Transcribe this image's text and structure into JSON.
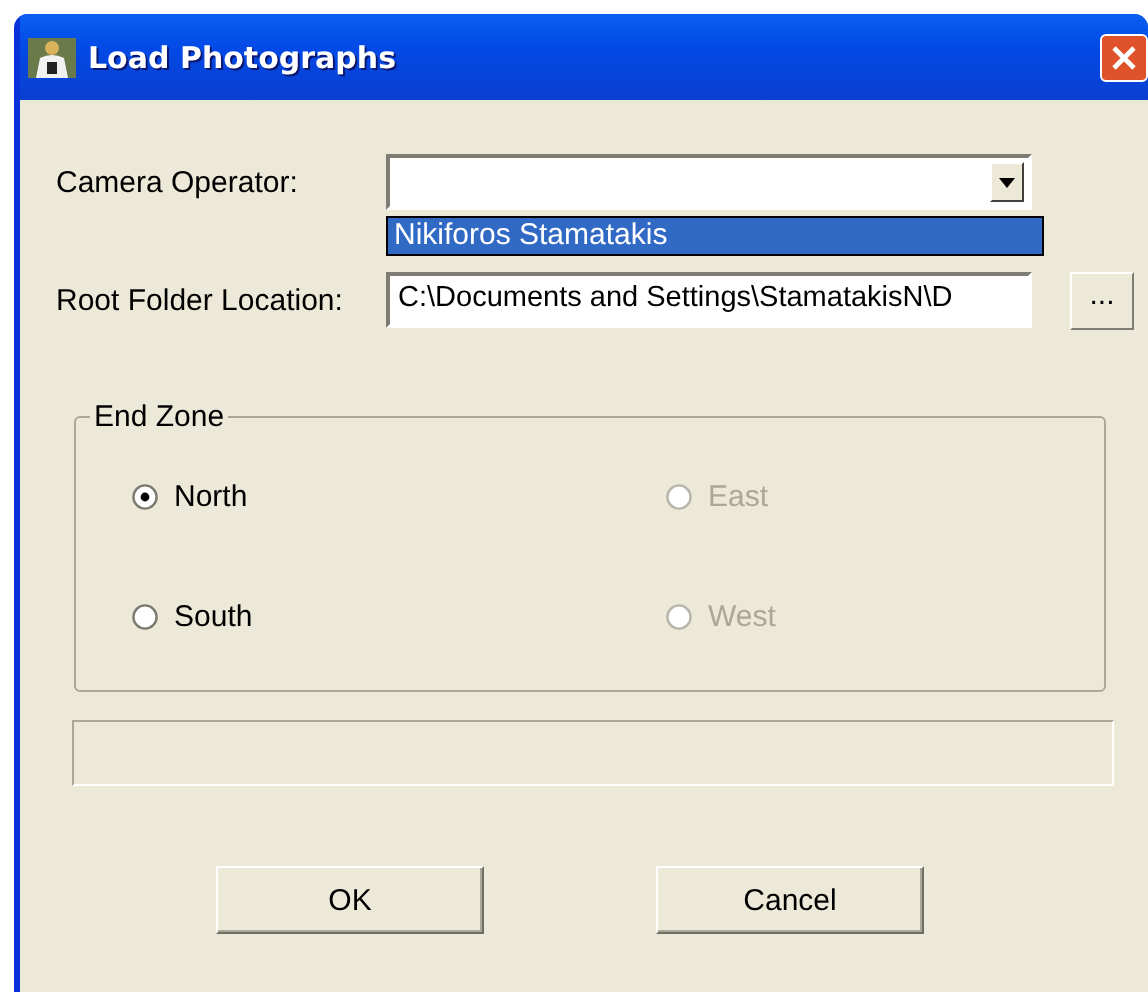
{
  "window": {
    "title": "Load Photographs"
  },
  "camera_operator": {
    "label": "Camera Operator:",
    "expanded": true,
    "options": [
      {
        "label": "Nikiforos Stamatakis",
        "selected": true
      }
    ]
  },
  "root_folder": {
    "label": "Root Folder Location:",
    "value": "C:\\Documents and Settings\\StamatakisN\\D",
    "browse_button": "..."
  },
  "end_zone": {
    "title": "End Zone",
    "options": [
      {
        "label": "North",
        "selected": true,
        "disabled": false
      },
      {
        "label": "East",
        "selected": false,
        "disabled": true
      },
      {
        "label": "South",
        "selected": false,
        "disabled": false
      },
      {
        "label": "West",
        "selected": false,
        "disabled": true
      }
    ]
  },
  "buttons": [
    "OK",
    "Cancel"
  ]
}
